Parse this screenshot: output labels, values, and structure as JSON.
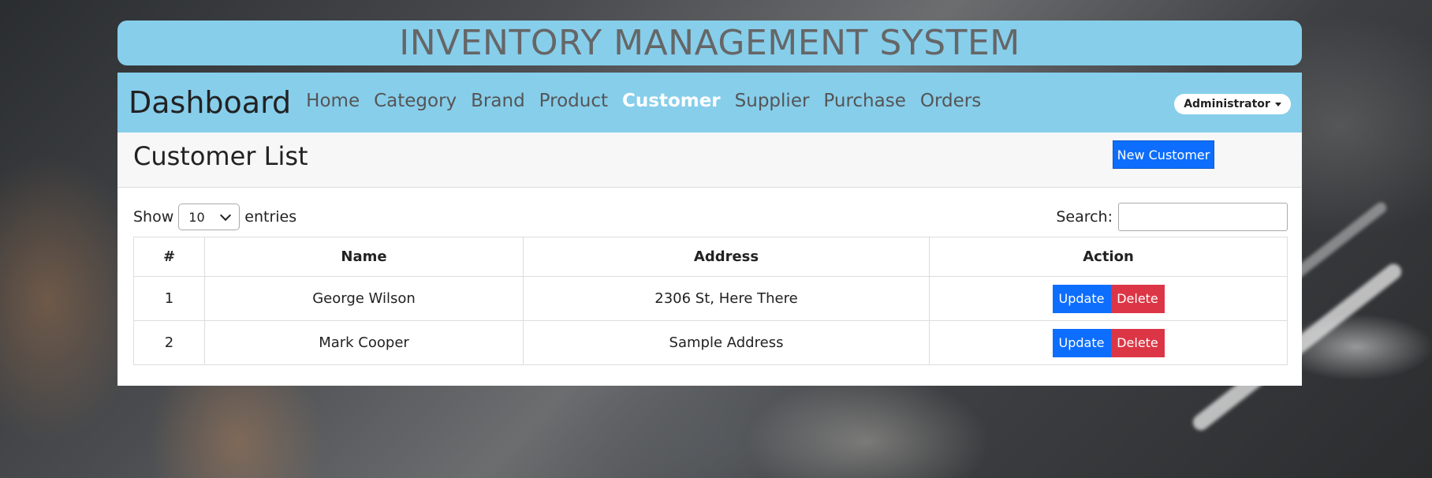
{
  "header": {
    "title": "INVENTORY MANAGEMENT SYSTEM"
  },
  "navbar": {
    "brand": "Dashboard",
    "links": [
      {
        "label": "Home"
      },
      {
        "label": "Category"
      },
      {
        "label": "Brand"
      },
      {
        "label": "Product"
      },
      {
        "label": "Customer",
        "active": true
      },
      {
        "label": "Supplier"
      },
      {
        "label": "Purchase"
      },
      {
        "label": "Orders"
      }
    ],
    "user_menu": "Administrator"
  },
  "page": {
    "title": "Customer List",
    "new_button": "New Customer"
  },
  "controls": {
    "show_label": "Show",
    "entries_value": "10",
    "entries_label": "entries",
    "search_label": "Search:",
    "search_value": ""
  },
  "table": {
    "columns": [
      "#",
      "Name",
      "Address",
      "Action"
    ],
    "rows": [
      {
        "num": "1",
        "name": "George Wilson",
        "address": "2306 St, Here There"
      },
      {
        "num": "2",
        "name": "Mark Cooper",
        "address": "Sample Address"
      }
    ],
    "update_label": "Update",
    "delete_label": "Delete"
  },
  "colors": {
    "navbar": "#87ceeb",
    "primary": "#0d6efd",
    "danger": "#dc3545"
  }
}
